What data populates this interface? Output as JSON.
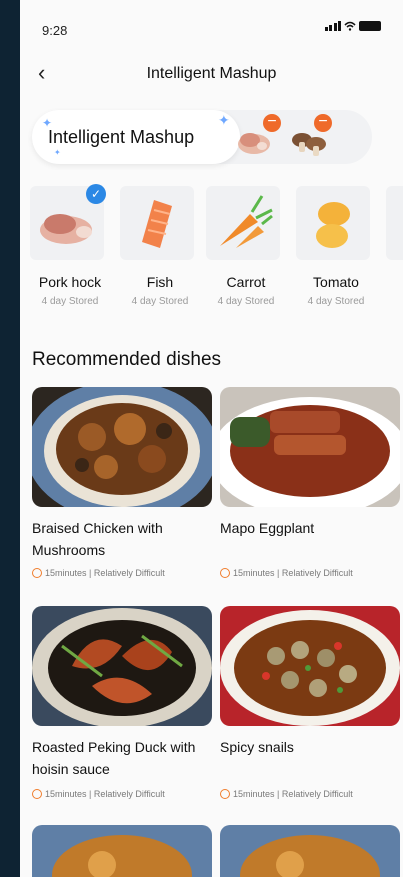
{
  "status": {
    "time": "9:28"
  },
  "nav": {
    "title": "Intelligent Mashup"
  },
  "mashup": {
    "label": "Intelligent Mashup"
  },
  "ingredients": [
    {
      "name": "Pork hock",
      "stored": "4 day Stored",
      "selected": true
    },
    {
      "name": "Fish",
      "stored": "4 day Stored"
    },
    {
      "name": "Carrot",
      "stored": "4 day Stored"
    },
    {
      "name": "Tomato",
      "stored": "4 day Stored"
    }
  ],
  "section": {
    "title": "Recommended dishes"
  },
  "dishes": [
    {
      "name": "Braised Chicken with Mushrooms",
      "meta": "15minutes | Relatively Difficult"
    },
    {
      "name": "Mapo Eggplant",
      "meta": "15minutes | Relatively Difficult"
    },
    {
      "name": "Roasted Peking Duck with hoisin sauce",
      "meta": "15minutes | Relatively Difficult"
    },
    {
      "name": "Spicy snails",
      "meta": "15minutes | Relatively Difficult"
    }
  ],
  "colors": {
    "accent": "#2b88e5",
    "remove": "#ef6a2a",
    "clock": "#f07d2c"
  },
  "icons": {
    "back": "chevron-left-icon",
    "selected": "checkmark-icon",
    "remove": "minus-icon",
    "time": "clock-icon"
  }
}
